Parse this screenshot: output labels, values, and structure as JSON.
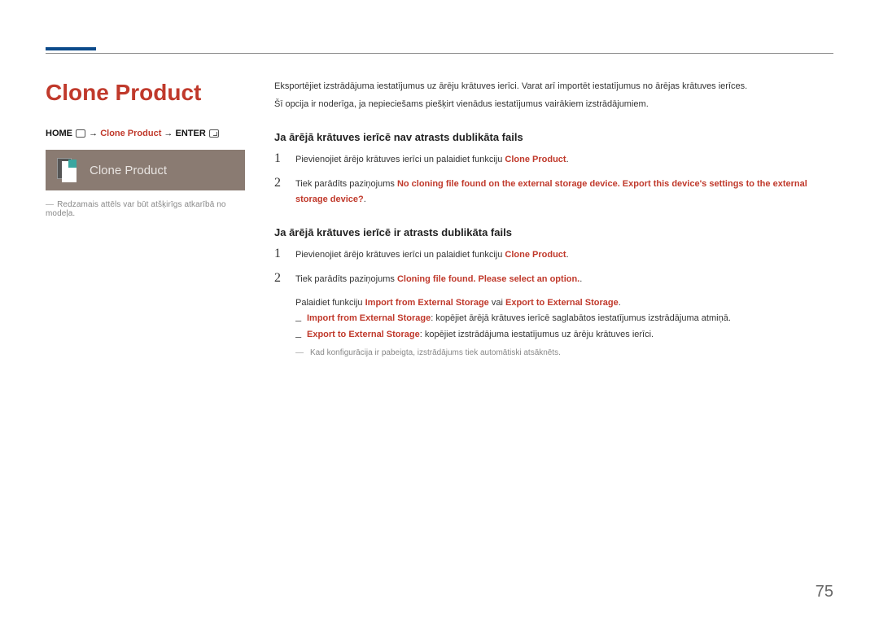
{
  "title": "Clone Product",
  "breadcrumb": {
    "home": "HOME",
    "mid": "Clone Product",
    "enter": "ENTER"
  },
  "tile": {
    "label": "Clone Product"
  },
  "left_note": "Redzamais attēls var būt atšķirīgs atkarībā no modeļa.",
  "intro": {
    "p1": "Eksportējiet izstrādājuma iestatījumus uz ārēju krātuves ierīci. Varat arī importēt iestatījumus no ārējas krātuves ierīces.",
    "p2": "Šī opcija ir noderīga, ja nepieciešams piešķirt vienādus iestatījumus vairākiem izstrādājumiem."
  },
  "sec1": {
    "head": "Ja ārējā krātuves ierīcē nav atrasts dublikāta fails",
    "i1_a": "Pievienojiet ārējo krātuves ierīci un palaidiet funkciju ",
    "i1_b": "Clone Product",
    "i2_a": "Tiek parādīts paziņojums ",
    "i2_b": "No cloning file found on the external storage device. Export this device's settings to the external storage device?"
  },
  "sec2": {
    "head": "Ja ārējā krātuves ierīcē ir atrasts dublikāta fails",
    "i1_a": "Pievienojiet ārējo krātuves ierīci un palaidiet funkciju ",
    "i1_b": "Clone Product",
    "i2_a": "Tiek parādīts paziņojums ",
    "i2_b": "Cloning file found. Please select an option.",
    "run_a": "Palaidiet funkciju ",
    "imp": "Import from External Storage",
    "mid": " vai ",
    "exp": "Export to External Storage",
    "d1_a": "Import from External Storage",
    "d1_b": ": kopējiet ārējā krātuves ierīcē saglabātos iestatījumus izstrādājuma atmiņā.",
    "d2_a": "Export to External Storage",
    "d2_b": ": kopējiet izstrādājuma iestatījumus uz ārēju krātuves ierīci.",
    "foot": "Kad konfigurācija ir pabeigta, izstrādājums tiek automātiski atsāknēts."
  },
  "page_number": "75"
}
